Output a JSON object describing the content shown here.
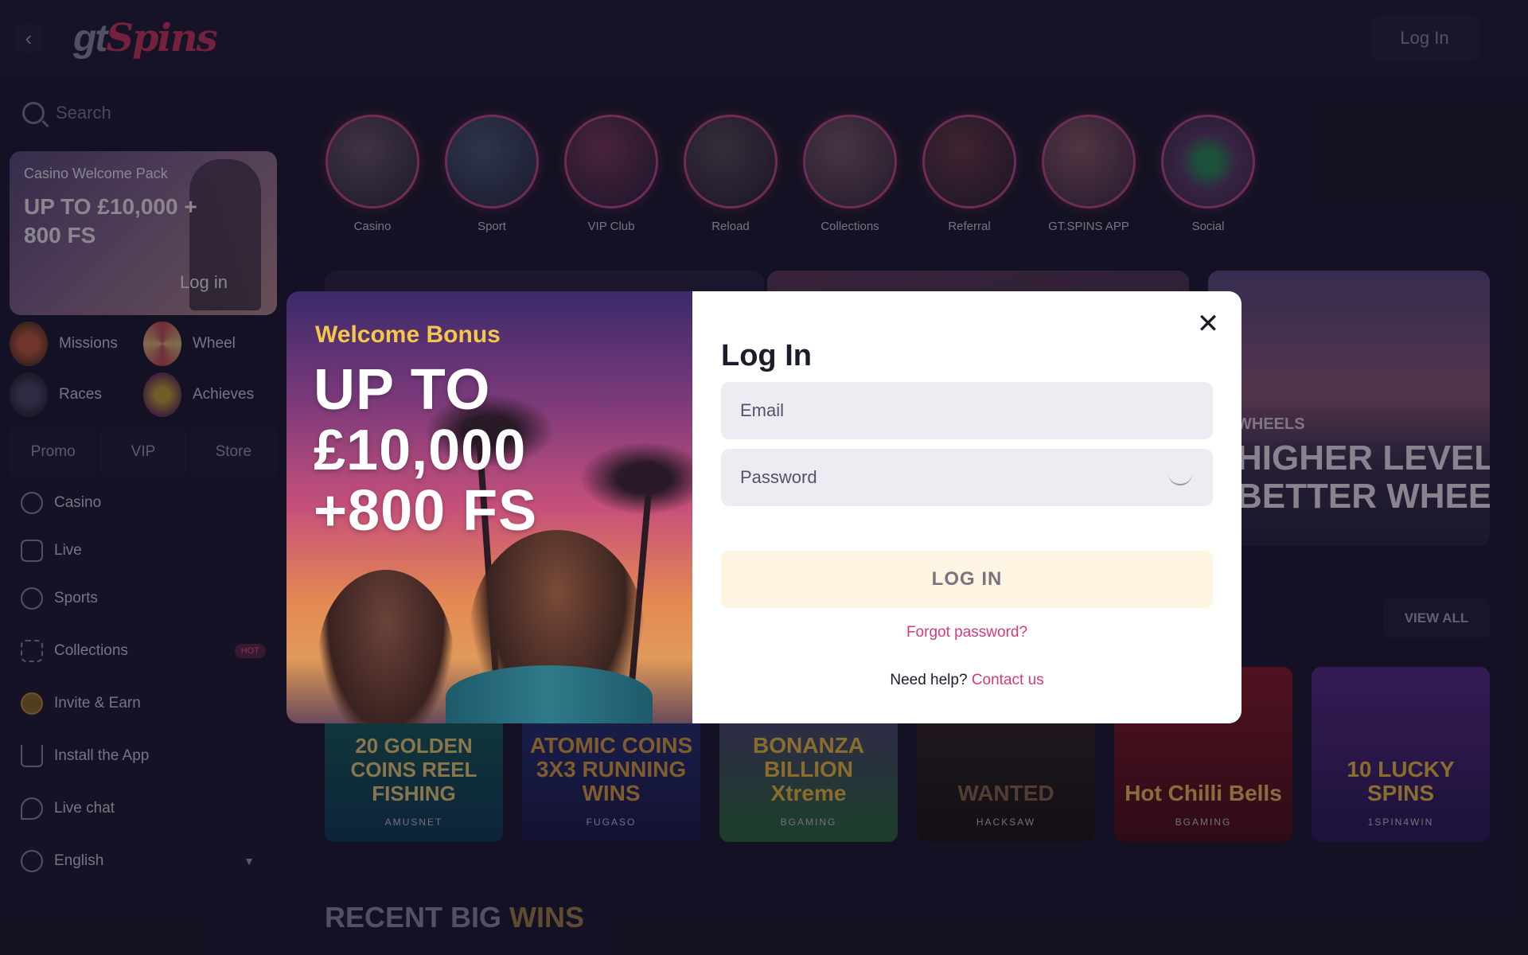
{
  "header": {
    "logo_gt": "gt",
    "logo_spins": "Spins",
    "login_label": "Log In"
  },
  "sidebar": {
    "search_placeholder": "Search",
    "promo": {
      "title": "Casino Welcome Pack",
      "amount": "UP TO £10,000 + 800 FS",
      "login": "Log in"
    },
    "tiles": [
      {
        "label": "Missions",
        "icon": "target-icon"
      },
      {
        "label": "Wheel",
        "icon": "wheel-icon"
      },
      {
        "label": "Races",
        "icon": "race-icon"
      },
      {
        "label": "Achieves",
        "icon": "medal-icon"
      }
    ],
    "tabs": [
      "Promo",
      "VIP",
      "Store"
    ],
    "nav": [
      {
        "label": "Casino",
        "icon": "casino-icon"
      },
      {
        "label": "Live",
        "icon": "dice-icon"
      },
      {
        "label": "Sports",
        "icon": "soccer-ball-icon"
      },
      {
        "label": "Collections",
        "icon": "grid-icon",
        "badge": "HOT"
      },
      {
        "label": "Invite & Earn",
        "icon": "coins-icon"
      },
      {
        "label": "Install the App",
        "icon": "download-icon"
      },
      {
        "label": "Live chat",
        "icon": "chat-icon"
      },
      {
        "label": "English",
        "icon": "globe-icon"
      }
    ]
  },
  "categories": [
    "Casino",
    "Sport",
    "VIP Club",
    "Reload",
    "Collections",
    "Referral",
    "GT.SPINS APP",
    "Social"
  ],
  "banner_right": {
    "tag": "WHEELS",
    "headline": "HIGHER LEVEL\nBETTER WHEEL"
  },
  "view_all": "VIEW ALL",
  "games": [
    {
      "title": "20 GOLDEN COINS REEL FISHING",
      "provider": "AMUSNET"
    },
    {
      "title": "ATOMIC COINS 3X3 RUNNING WINS",
      "provider": "FUGASO"
    },
    {
      "title": "BONANZA BILLION Xtreme",
      "provider": "BGAMING"
    },
    {
      "title": "WANTED",
      "provider": "HACKSAW"
    },
    {
      "title": "Hot Chilli Bells",
      "provider": "BGAMING"
    },
    {
      "title": "10 LUCKY SPINS",
      "provider": "1SPIN4WIN"
    }
  ],
  "recent": {
    "part1": "RECENT BIG ",
    "part2": "WINS"
  },
  "modal": {
    "welcome_label": "Welcome Bonus",
    "amount_line1": "UP TO",
    "amount_line2": "£10,000",
    "amount_line3": "+800 FS",
    "title": "Log In",
    "email_placeholder": "Email",
    "password_placeholder": "Password",
    "login_button": "LOG IN",
    "forgot": "Forgot password?",
    "help_text": "Need help?",
    "contact": "Contact us"
  },
  "colors": {
    "bg": "#1b1930",
    "accent_pink": "#d33a7c",
    "gold": "#f5c64a",
    "login_btn_bg": "#fdf4e2"
  }
}
